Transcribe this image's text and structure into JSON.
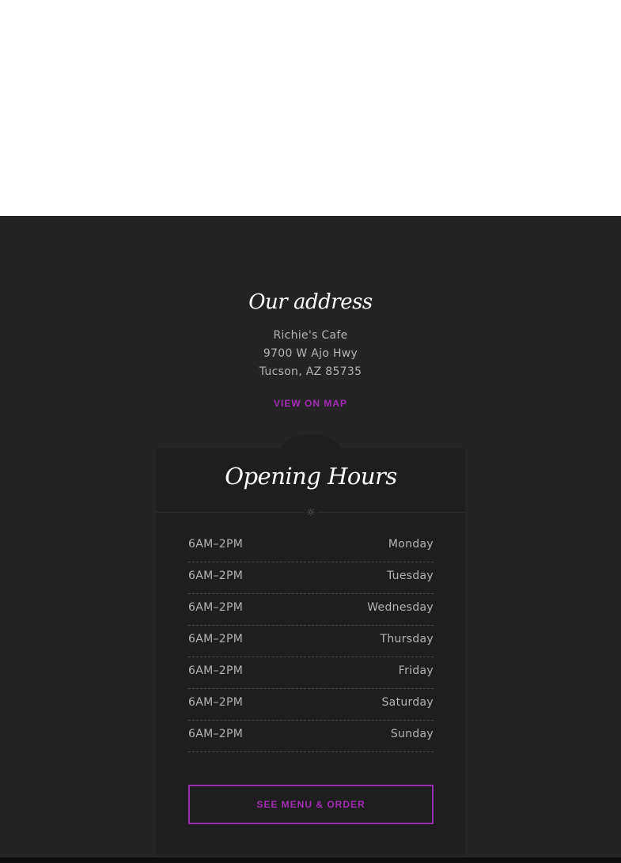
{
  "address": {
    "title": "Our address",
    "lines": [
      "Richie's Cafe",
      "9700 W Ajo Hwy",
      "Tucson, AZ 85735"
    ],
    "map_link": "VIEW ON MAP"
  },
  "hours": {
    "title": "Opening Hours",
    "divider_icon": "sun-icon",
    "rows": [
      {
        "time": "6AM–2PM",
        "day": "Monday"
      },
      {
        "time": "6AM–2PM",
        "day": "Tuesday"
      },
      {
        "time": "6AM–2PM",
        "day": "Wednesday"
      },
      {
        "time": "6AM–2PM",
        "day": "Thursday"
      },
      {
        "time": "6AM–2PM",
        "day": "Friday"
      },
      {
        "time": "6AM–2PM",
        "day": "Saturday"
      },
      {
        "time": "6AM–2PM",
        "day": "Sunday"
      }
    ],
    "order_button": "SEE MENU & ORDER"
  },
  "colors": {
    "accent": "#a42bb5",
    "background_dark": "#242424",
    "card": "#1e1e1e",
    "text_muted": "#b5b5b5"
  }
}
